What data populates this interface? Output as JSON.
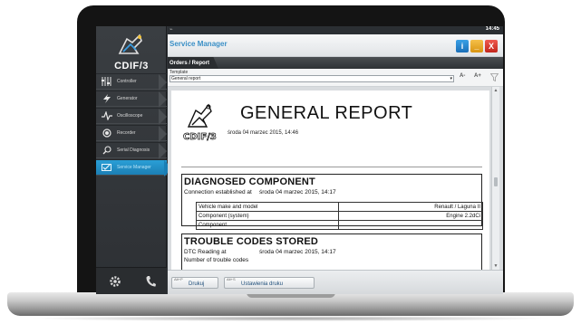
{
  "sidebar": {
    "brand": "CDIF/3",
    "items": [
      {
        "label": "Controller",
        "icon": "controller-icon"
      },
      {
        "label": "Generator",
        "icon": "generator-icon"
      },
      {
        "label": "Oscilloscope",
        "icon": "oscilloscope-icon"
      },
      {
        "label": "Recorder",
        "icon": "recorder-icon"
      },
      {
        "label": "Serial Diagnosis",
        "icon": "search-icon"
      },
      {
        "label": "Service Manager",
        "icon": "service-manager-icon",
        "active": true
      }
    ],
    "bottom_icons": [
      "settings-icon",
      "phone-icon"
    ]
  },
  "statusbar": {
    "clock": "14:45"
  },
  "window": {
    "title": "Service Manager",
    "accent": "#3a8fc6",
    "buttons": {
      "info": "i",
      "minimize": "_",
      "close": "X"
    }
  },
  "breadcrumb": "Orders / Report",
  "template": {
    "label": "Template",
    "selected": "General report",
    "tools": [
      "A-",
      "A+"
    ]
  },
  "report": {
    "logo_text": "CDIF/3",
    "title": "GENERAL REPORT",
    "date": "środa 04 marzec 2015, 14:46",
    "sections": [
      {
        "heading": "DIAGNOSED COMPONENT",
        "line_label": "Connection established at",
        "line_value": "środa 04 marzec 2015, 14:17",
        "rows": [
          {
            "label": "Vehicle make and model",
            "value": "Renault / Laguna II"
          },
          {
            "label": "Component (system)",
            "value": "Engine 2.2dCi"
          },
          {
            "label": "Component",
            "value": ""
          }
        ]
      },
      {
        "heading": "TROUBLE CODES STORED",
        "line_label": "DTC Reading at",
        "line_value": "środa 04 marzec 2015, 14:17",
        "line2_label": "Number of trouble codes"
      }
    ]
  },
  "bottom_buttons": [
    {
      "hotkey": "Alt+P",
      "label": "Drukuj"
    },
    {
      "hotkey": "Alt+S",
      "label": "Ustawienia druku"
    }
  ]
}
